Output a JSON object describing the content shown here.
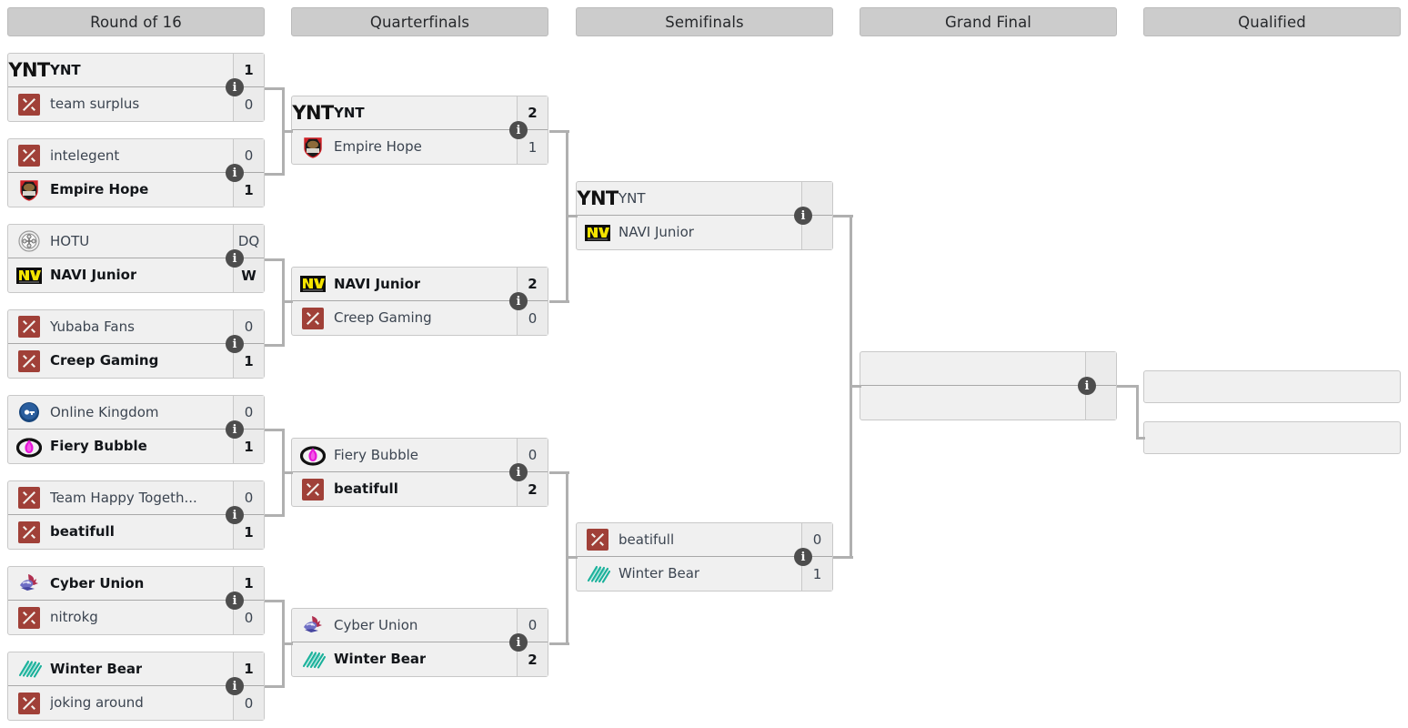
{
  "title": "Tournament Bracket",
  "rounds": [
    {
      "id": "r16",
      "label": "Round of 16"
    },
    {
      "id": "qf",
      "label": "Quarterfinals"
    },
    {
      "id": "sf",
      "label": "Semifinals"
    },
    {
      "id": "gf",
      "label": "Grand Final"
    },
    {
      "id": "qual",
      "label": "Qualified"
    }
  ],
  "info_icon": "i",
  "colors": {
    "header_bg": "#cccccc",
    "match_bg": "#f0f0f0",
    "score_bg": "#ebebeb",
    "border": "#c8c8c8",
    "connector": "#b0b0b0",
    "info_badge": "#4d4d4d",
    "text": "#3b4450",
    "text_winner": "#13161a"
  },
  "matches": {
    "r16_m1": {
      "top": {
        "name": "YNT",
        "score": "1",
        "winner": true,
        "logo": "ynt-text-logo"
      },
      "bottom": {
        "name": "team surplus",
        "score": "0",
        "winner": false,
        "logo": "dota-default-logo"
      }
    },
    "r16_m2": {
      "top": {
        "name": "intelegent",
        "score": "0",
        "winner": false,
        "logo": "dota-default-logo"
      },
      "bottom": {
        "name": "Empire Hope",
        "score": "1",
        "winner": true,
        "logo": "empire-hope-logo"
      }
    },
    "r16_m3": {
      "top": {
        "name": "HOTU",
        "score": "DQ",
        "winner": false,
        "logo": "hotu-logo"
      },
      "bottom": {
        "name": "NAVI Junior",
        "score": "W",
        "winner": true,
        "logo": "navi-logo"
      }
    },
    "r16_m4": {
      "top": {
        "name": "Yubaba Fans",
        "score": "0",
        "winner": false,
        "logo": "dota-default-logo"
      },
      "bottom": {
        "name": "Creep Gaming",
        "score": "1",
        "winner": true,
        "logo": "dota-default-logo"
      }
    },
    "r16_m5": {
      "top": {
        "name": "Online Kingdom",
        "score": "0",
        "winner": false,
        "logo": "online-kingdom-logo"
      },
      "bottom": {
        "name": "Fiery Bubble",
        "score": "1",
        "winner": true,
        "logo": "fiery-bubble-logo"
      }
    },
    "r16_m6": {
      "top": {
        "name": "Team Happy Togeth...",
        "score": "0",
        "winner": false,
        "logo": "dota-default-logo"
      },
      "bottom": {
        "name": "beatifull",
        "score": "1",
        "winner": true,
        "logo": "dota-default-logo"
      }
    },
    "r16_m7": {
      "top": {
        "name": "Cyber Union",
        "score": "1",
        "winner": true,
        "logo": "cyber-union-logo"
      },
      "bottom": {
        "name": "nitrokg",
        "score": "0",
        "winner": false,
        "logo": "dota-default-logo"
      }
    },
    "r16_m8": {
      "top": {
        "name": "Winter Bear",
        "score": "1",
        "winner": true,
        "logo": "winter-bear-logo"
      },
      "bottom": {
        "name": "joking around",
        "score": "0",
        "winner": false,
        "logo": "dota-default-logo"
      }
    },
    "qf_m1": {
      "top": {
        "name": "YNT",
        "score": "2",
        "winner": true,
        "logo": "ynt-text-logo"
      },
      "bottom": {
        "name": "Empire Hope",
        "score": "1",
        "winner": false,
        "logo": "empire-hope-logo"
      }
    },
    "qf_m2": {
      "top": {
        "name": "NAVI Junior",
        "score": "2",
        "winner": true,
        "logo": "navi-logo"
      },
      "bottom": {
        "name": "Creep Gaming",
        "score": "0",
        "winner": false,
        "logo": "dota-default-logo"
      }
    },
    "qf_m3": {
      "top": {
        "name": "Fiery Bubble",
        "score": "0",
        "winner": false,
        "logo": "fiery-bubble-logo"
      },
      "bottom": {
        "name": "beatifull",
        "score": "2",
        "winner": true,
        "logo": "dota-default-logo"
      }
    },
    "qf_m4": {
      "top": {
        "name": "Cyber Union",
        "score": "0",
        "winner": false,
        "logo": "cyber-union-logo"
      },
      "bottom": {
        "name": "Winter Bear",
        "score": "2",
        "winner": true,
        "logo": "winter-bear-logo"
      }
    },
    "sf_m1": {
      "top": {
        "name": "YNT",
        "score": "",
        "winner": false,
        "logo": "ynt-text-logo"
      },
      "bottom": {
        "name": "NAVI Junior",
        "score": "",
        "winner": false,
        "logo": "navi-logo"
      }
    },
    "sf_m2": {
      "top": {
        "name": "beatifull",
        "score": "0",
        "winner": false,
        "logo": "dota-default-logo"
      },
      "bottom": {
        "name": "Winter Bear",
        "score": "1",
        "winner": false,
        "logo": "winter-bear-logo"
      }
    },
    "gf_m1": {
      "top": {
        "name": "",
        "score": "",
        "winner": false,
        "logo": "none"
      },
      "bottom": {
        "name": "",
        "score": "",
        "winner": false,
        "logo": "none"
      }
    }
  },
  "qualified": [
    {
      "name": ""
    },
    {
      "name": ""
    }
  ]
}
